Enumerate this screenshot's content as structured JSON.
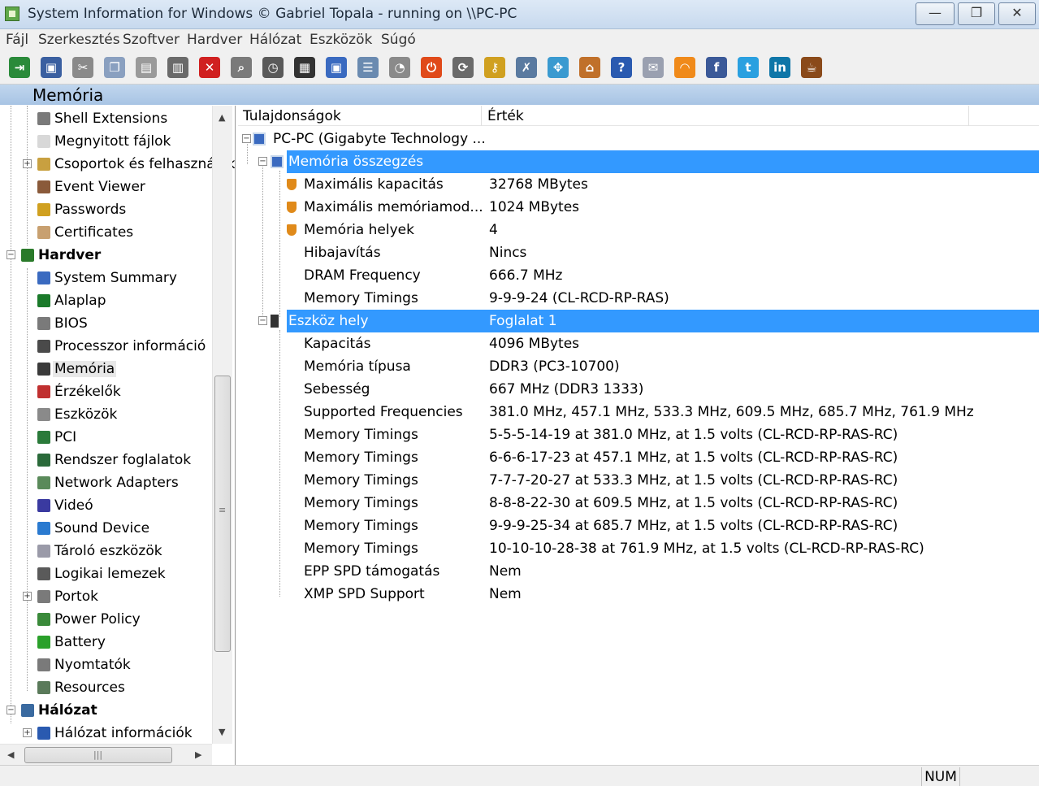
{
  "window": {
    "title": "System Information for Windows  © Gabriel Topala - running on \\\\PC-PC",
    "minimize": "—",
    "maximize": "❐",
    "close": "✕"
  },
  "menu": [
    "Fájl",
    "Szerkesztés",
    "Szoftver",
    "Hardver",
    "Hálózat",
    "Eszközök",
    "Súgó"
  ],
  "toolbar": [
    {
      "name": "exit-icon",
      "glyph": "⇥",
      "color": "#2a8a3a"
    },
    {
      "name": "save-icon",
      "glyph": "▣",
      "color": "#3a5fa0"
    },
    {
      "name": "cut-icon",
      "glyph": "✂",
      "color": "#8a8a8a"
    },
    {
      "name": "copy-icon",
      "glyph": "❐",
      "color": "#8aa0c0"
    },
    {
      "name": "paste-icon",
      "glyph": "▤",
      "color": "#9a9a9a"
    },
    {
      "name": "print-icon",
      "glyph": "▥",
      "color": "#6a6a6a"
    },
    {
      "name": "stop-icon",
      "glyph": "✕",
      "color": "#d02020"
    },
    {
      "name": "find-icon",
      "glyph": "⌕",
      "color": "#7a7a7a"
    },
    {
      "name": "gauge-icon",
      "glyph": "◷",
      "color": "#5a5a5a"
    },
    {
      "name": "monitor-icon",
      "glyph": "▦",
      "color": "#333333"
    },
    {
      "name": "network-icon",
      "glyph": "▣",
      "color": "#3a6ac0"
    },
    {
      "name": "report-icon",
      "glyph": "☰",
      "color": "#6a8ab0"
    },
    {
      "name": "stopwatch-icon",
      "glyph": "◔",
      "color": "#8a8a8a"
    },
    {
      "name": "shutdown-icon",
      "glyph": "⏻",
      "color": "#e04a1a"
    },
    {
      "name": "refresh-icon",
      "glyph": "⟳",
      "color": "#6a6a6a"
    },
    {
      "name": "key-icon",
      "glyph": "⚷",
      "color": "#d0a020"
    },
    {
      "name": "tools-icon",
      "glyph": "✗",
      "color": "#5a7aa0"
    },
    {
      "name": "puzzle-icon",
      "glyph": "✥",
      "color": "#3a9ad0"
    },
    {
      "name": "home-icon",
      "glyph": "⌂",
      "color": "#c0702a"
    },
    {
      "name": "help-icon",
      "glyph": "?",
      "color": "#2a5ab0"
    },
    {
      "name": "mail-icon",
      "glyph": "✉",
      "color": "#9aa0b0"
    },
    {
      "name": "rss-icon",
      "glyph": "◠",
      "color": "#f08a1a"
    },
    {
      "name": "facebook-icon",
      "glyph": "f",
      "color": "#3b5998"
    },
    {
      "name": "twitter-icon",
      "glyph": "t",
      "color": "#2aa0e0"
    },
    {
      "name": "linkedin-icon",
      "glyph": "in",
      "color": "#0e76a8"
    },
    {
      "name": "coffee-icon",
      "glyph": "☕",
      "color": "#8a4a1a"
    }
  ],
  "section_title": "Memória",
  "tree": [
    {
      "label": "Shell Extensions",
      "level": 1,
      "icon": "shell-icon",
      "color": "#7a7a7a"
    },
    {
      "label": "Megnyitott fájlok",
      "level": 1,
      "icon": "file-icon",
      "color": "#d8d8d8"
    },
    {
      "label": "Csoportok és felhasználók",
      "level": 1,
      "icon": "users-icon",
      "color": "#c8a040",
      "expander": "+"
    },
    {
      "label": "Event Viewer",
      "level": 1,
      "icon": "event-viewer-icon",
      "color": "#8a5a3a"
    },
    {
      "label": "Passwords",
      "level": 1,
      "icon": "key-icon",
      "color": "#d0a020"
    },
    {
      "label": "Certificates",
      "level": 1,
      "icon": "certificate-icon",
      "color": "#c8a070"
    },
    {
      "label": "Hardver",
      "level": 0,
      "icon": "hardware-icon",
      "color": "#2a7a2a",
      "bold": true,
      "expander": "−"
    },
    {
      "label": "System Summary",
      "level": 1,
      "icon": "computer-icon",
      "color": "#3a6ac0"
    },
    {
      "label": "Alaplap",
      "level": 1,
      "icon": "motherboard-icon",
      "color": "#1a7a2a"
    },
    {
      "label": "BIOS",
      "level": 1,
      "icon": "bios-chip-icon",
      "color": "#7a7a7a"
    },
    {
      "label": "Processzor információ",
      "level": 1,
      "icon": "cpu-icon",
      "color": "#4a4a4a"
    },
    {
      "label": "Memória",
      "level": 1,
      "icon": "memory-icon",
      "color": "#3a3a3a",
      "selected": true
    },
    {
      "label": "Érzékelők",
      "level": 1,
      "icon": "sensor-icon",
      "color": "#c03030"
    },
    {
      "label": "Eszközök",
      "level": 1,
      "icon": "devices-icon",
      "color": "#8a8a8a"
    },
    {
      "label": "PCI",
      "level": 1,
      "icon": "pci-card-icon",
      "color": "#2a7a3a"
    },
    {
      "label": "Rendszer foglalatok",
      "level": 1,
      "icon": "slots-icon",
      "color": "#2a6a3a"
    },
    {
      "label": "Network Adapters",
      "level": 1,
      "icon": "network-adapter-icon",
      "color": "#5a8a5a"
    },
    {
      "label": "Videó",
      "level": 1,
      "icon": "video-icon",
      "color": "#3a3aa0"
    },
    {
      "label": "Sound Device",
      "level": 1,
      "icon": "sound-icon",
      "color": "#2a7ad0"
    },
    {
      "label": "Tároló eszközök",
      "level": 1,
      "icon": "storage-icon",
      "color": "#9a9aa8"
    },
    {
      "label": "Logikai lemezek",
      "level": 1,
      "icon": "disk-icon",
      "color": "#5a5a5a"
    },
    {
      "label": "Portok",
      "level": 1,
      "icon": "ports-icon",
      "color": "#7a7a7a",
      "expander": "+"
    },
    {
      "label": "Power Policy",
      "level": 1,
      "icon": "power-icon",
      "color": "#3a8a3a"
    },
    {
      "label": "Battery",
      "level": 1,
      "icon": "battery-icon",
      "color": "#2aa02a"
    },
    {
      "label": "Nyomtatók",
      "level": 1,
      "icon": "printer-icon",
      "color": "#7a7a7a"
    },
    {
      "label": "Resources",
      "level": 1,
      "icon": "resources-icon",
      "color": "#5a7a5a"
    },
    {
      "label": "Hálózat",
      "level": 0,
      "icon": "network-icon",
      "color": "#3a6aa0",
      "bold": true,
      "expander": "−"
    },
    {
      "label": "Hálózat információk",
      "level": 1,
      "icon": "info-icon",
      "color": "#2a5ab0",
      "expander": "+"
    }
  ],
  "columns": {
    "property": "Tulajdonságok",
    "value": "Érték"
  },
  "rows": [
    {
      "label": "PC-PC (Gigabyte Technology ...",
      "value": "",
      "level": 0,
      "icon": "computer-icon",
      "expander": "−"
    },
    {
      "label": "Memória összegzés",
      "value": "",
      "level": 1,
      "icon": "computer-icon",
      "expander": "−",
      "highlight": true
    },
    {
      "label": "Maximális kapacitás",
      "value": "32768 MBytes",
      "level": 2,
      "icon": "shield-icon"
    },
    {
      "label": "Maximális memóriamod...",
      "value": "1024 MBytes",
      "level": 2,
      "icon": "shield-icon"
    },
    {
      "label": "Memória helyek",
      "value": "4",
      "level": 2,
      "icon": "shield-icon"
    },
    {
      "label": "Hibajavítás",
      "value": "Nincs",
      "level": 2
    },
    {
      "label": "DRAM Frequency",
      "value": "666.7 MHz",
      "level": 2
    },
    {
      "label": "Memory Timings",
      "value": "9-9-9-24 (CL-RCD-RP-RAS)",
      "level": 2
    },
    {
      "label": "Eszköz hely",
      "value": "Foglalat 1",
      "level": 1,
      "icon": "memory-icon",
      "expander": "−",
      "highlight": true
    },
    {
      "label": "Kapacitás",
      "value": "4096 MBytes",
      "level": 2
    },
    {
      "label": "Memória típusa",
      "value": "DDR3 (PC3-10700)",
      "level": 2
    },
    {
      "label": "Sebesség",
      "value": "667 MHz (DDR3 1333)",
      "level": 2
    },
    {
      "label": "Supported Frequencies",
      "value": "381.0 MHz, 457.1 MHz, 533.3 MHz, 609.5 MHz, 685.7 MHz, 761.9 MHz",
      "level": 2
    },
    {
      "label": "Memory Timings",
      "value": "5-5-5-14-19 at 381.0 MHz, at 1.5 volts (CL-RCD-RP-RAS-RC)",
      "level": 2
    },
    {
      "label": "Memory Timings",
      "value": "6-6-6-17-23 at 457.1 MHz, at 1.5 volts (CL-RCD-RP-RAS-RC)",
      "level": 2
    },
    {
      "label": "Memory Timings",
      "value": "7-7-7-20-27 at 533.3 MHz, at 1.5 volts (CL-RCD-RP-RAS-RC)",
      "level": 2
    },
    {
      "label": "Memory Timings",
      "value": "8-8-8-22-30 at 609.5 MHz, at 1.5 volts (CL-RCD-RP-RAS-RC)",
      "level": 2
    },
    {
      "label": "Memory Timings",
      "value": "9-9-9-25-34 at 685.7 MHz, at 1.5 volts (CL-RCD-RP-RAS-RC)",
      "level": 2
    },
    {
      "label": "Memory Timings",
      "value": "10-10-10-28-38 at 761.9 MHz, at 1.5 volts (CL-RCD-RP-RAS-RC)",
      "level": 2
    },
    {
      "label": "EPP SPD támogatás",
      "value": "Nem",
      "level": 2
    },
    {
      "label": "XMP SPD Support",
      "value": "Nem",
      "level": 2
    }
  ],
  "status": {
    "num": "NUM"
  },
  "colors": {
    "highlight": "#3399ff",
    "section_header": "#b4cde9"
  }
}
